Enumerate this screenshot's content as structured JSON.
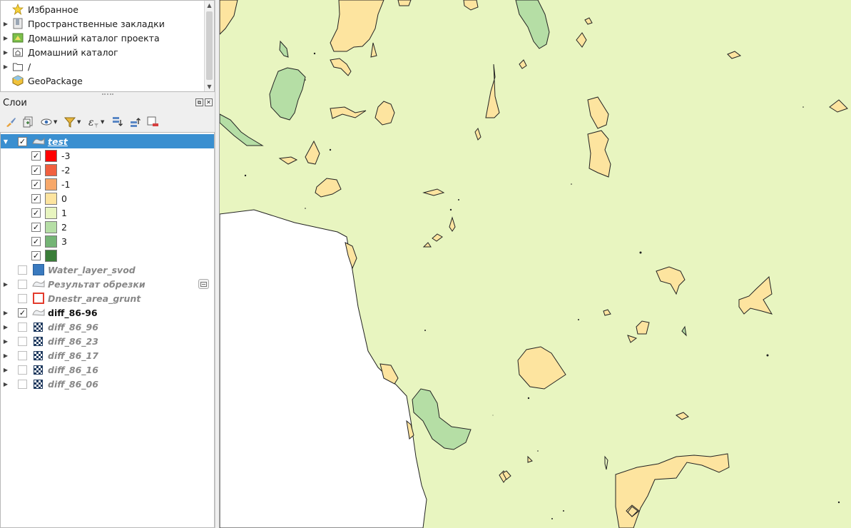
{
  "browser": {
    "items": [
      {
        "label": "Избранное",
        "icon": "star-icon",
        "expandable": false
      },
      {
        "label": "Пространственные закладки",
        "icon": "spatial-bookmarks-icon",
        "expandable": true
      },
      {
        "label": "Домашний каталог проекта",
        "icon": "project-home-icon",
        "expandable": true
      },
      {
        "label": "Домашний каталог",
        "icon": "home-folder-icon",
        "expandable": true
      },
      {
        "label": "/",
        "icon": "folder-icon",
        "expandable": true
      },
      {
        "label": "GeoPackage",
        "icon": "geopackage-icon",
        "expandable": false
      }
    ]
  },
  "layers_panel": {
    "title": "Слои",
    "toolbar": [
      "style-brush-icon",
      "add-group-icon",
      "visibility-icon",
      "filter-icon",
      "expression-filter-icon",
      "expand-all-icon",
      "collapse-all-icon",
      "remove-layer-icon"
    ]
  },
  "layers": {
    "test": {
      "name": "test",
      "checked": true,
      "expanded": true,
      "selected": true
    },
    "legend": [
      {
        "label": "-3",
        "color": "#ff0000"
      },
      {
        "label": "-2",
        "color": "#f1603f"
      },
      {
        "label": "-1",
        "color": "#f7a86a"
      },
      {
        "label": "0",
        "color": "#fde49f"
      },
      {
        "label": "1",
        "color": "#e8f5c0"
      },
      {
        "label": "2",
        "color": "#b5dea5"
      },
      {
        "label": "3",
        "color": "#74b475"
      },
      {
        "label": "",
        "color": "#3a7d38"
      }
    ],
    "others": [
      {
        "name": "Water_layer_svod",
        "type": "fill",
        "color": "#3a7abf",
        "checked": false,
        "expandable": false
      },
      {
        "name": "Результат обрезки",
        "type": "vector",
        "checked": false,
        "expandable": true,
        "extra_icon": "embedded-icon"
      },
      {
        "name": "Dnestr_area_grunt",
        "type": "outline",
        "color": "#e33b2c",
        "checked": false,
        "expandable": false
      },
      {
        "name": "diff_86-96",
        "type": "vector",
        "checked": true,
        "expandable": true,
        "active": true
      },
      {
        "name": "diff_86_96",
        "type": "raster",
        "checked": false,
        "expandable": true
      },
      {
        "name": "diff_86_23",
        "type": "raster",
        "checked": false,
        "expandable": true
      },
      {
        "name": "diff_86_17",
        "type": "raster",
        "checked": false,
        "expandable": true
      },
      {
        "name": "diff_86_16",
        "type": "raster",
        "checked": false,
        "expandable": true
      },
      {
        "name": "diff_86_06",
        "type": "raster",
        "checked": false,
        "expandable": true
      }
    ]
  },
  "map": {
    "colors": {
      "background": "#e8f5c0",
      "white_area": "#ffffff",
      "tan": "#fde49f",
      "green": "#b5dea5",
      "outline": "#222222"
    }
  }
}
